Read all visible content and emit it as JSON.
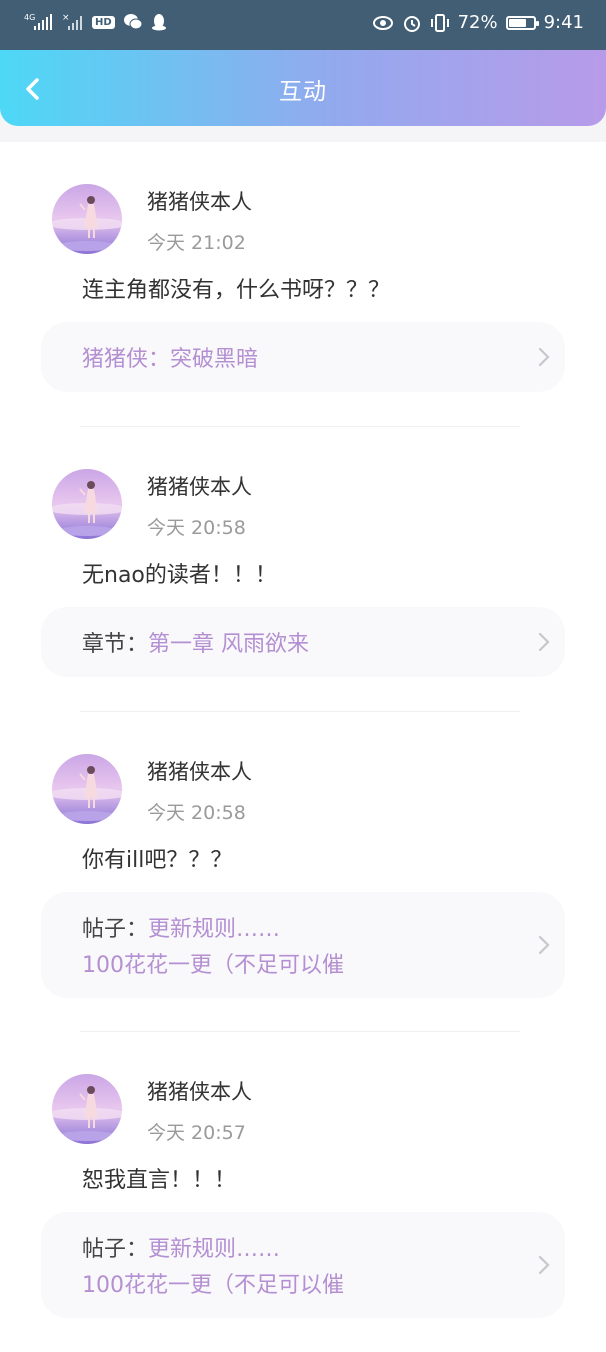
{
  "status_bar": {
    "network": "4G",
    "hd_badge": "HD",
    "battery_text": "72%",
    "battery_level": 0.72,
    "time": "9:41"
  },
  "header": {
    "title": "互动",
    "back_icon": "chevron-left-icon"
  },
  "colors": {
    "header_gradient": [
      "#4dd8f6",
      "#93a9ee",
      "#b79be9"
    ],
    "status_bar": "#415e74",
    "accent_purple": "#b48fd2"
  },
  "comments": [
    {
      "user": "猪猪侠本人",
      "time": "今天 21:02",
      "content": "连主角都没有，什么书呀？？？",
      "ref_prefix": "",
      "ref_text": "猪猪侠：突破黑暗",
      "ref_text2": ""
    },
    {
      "user": "猪猪侠本人",
      "time": "今天 20:58",
      "content": "无nao的读者！！！",
      "ref_prefix": "章节：",
      "ref_text": "第一章 风雨欲来",
      "ref_text2": ""
    },
    {
      "user": "猪猪侠本人",
      "time": "今天 20:58",
      "content": "你有ill吧？？？",
      "ref_prefix": "帖子：",
      "ref_text": "更新规则……",
      "ref_text2": "100花花一更（不足可以催"
    },
    {
      "user": "猪猪侠本人",
      "time": "今天 20:57",
      "content": "恕我直言！！！",
      "ref_prefix": "帖子：",
      "ref_text": "更新规则……",
      "ref_text2": "100花花一更（不足可以催"
    }
  ]
}
